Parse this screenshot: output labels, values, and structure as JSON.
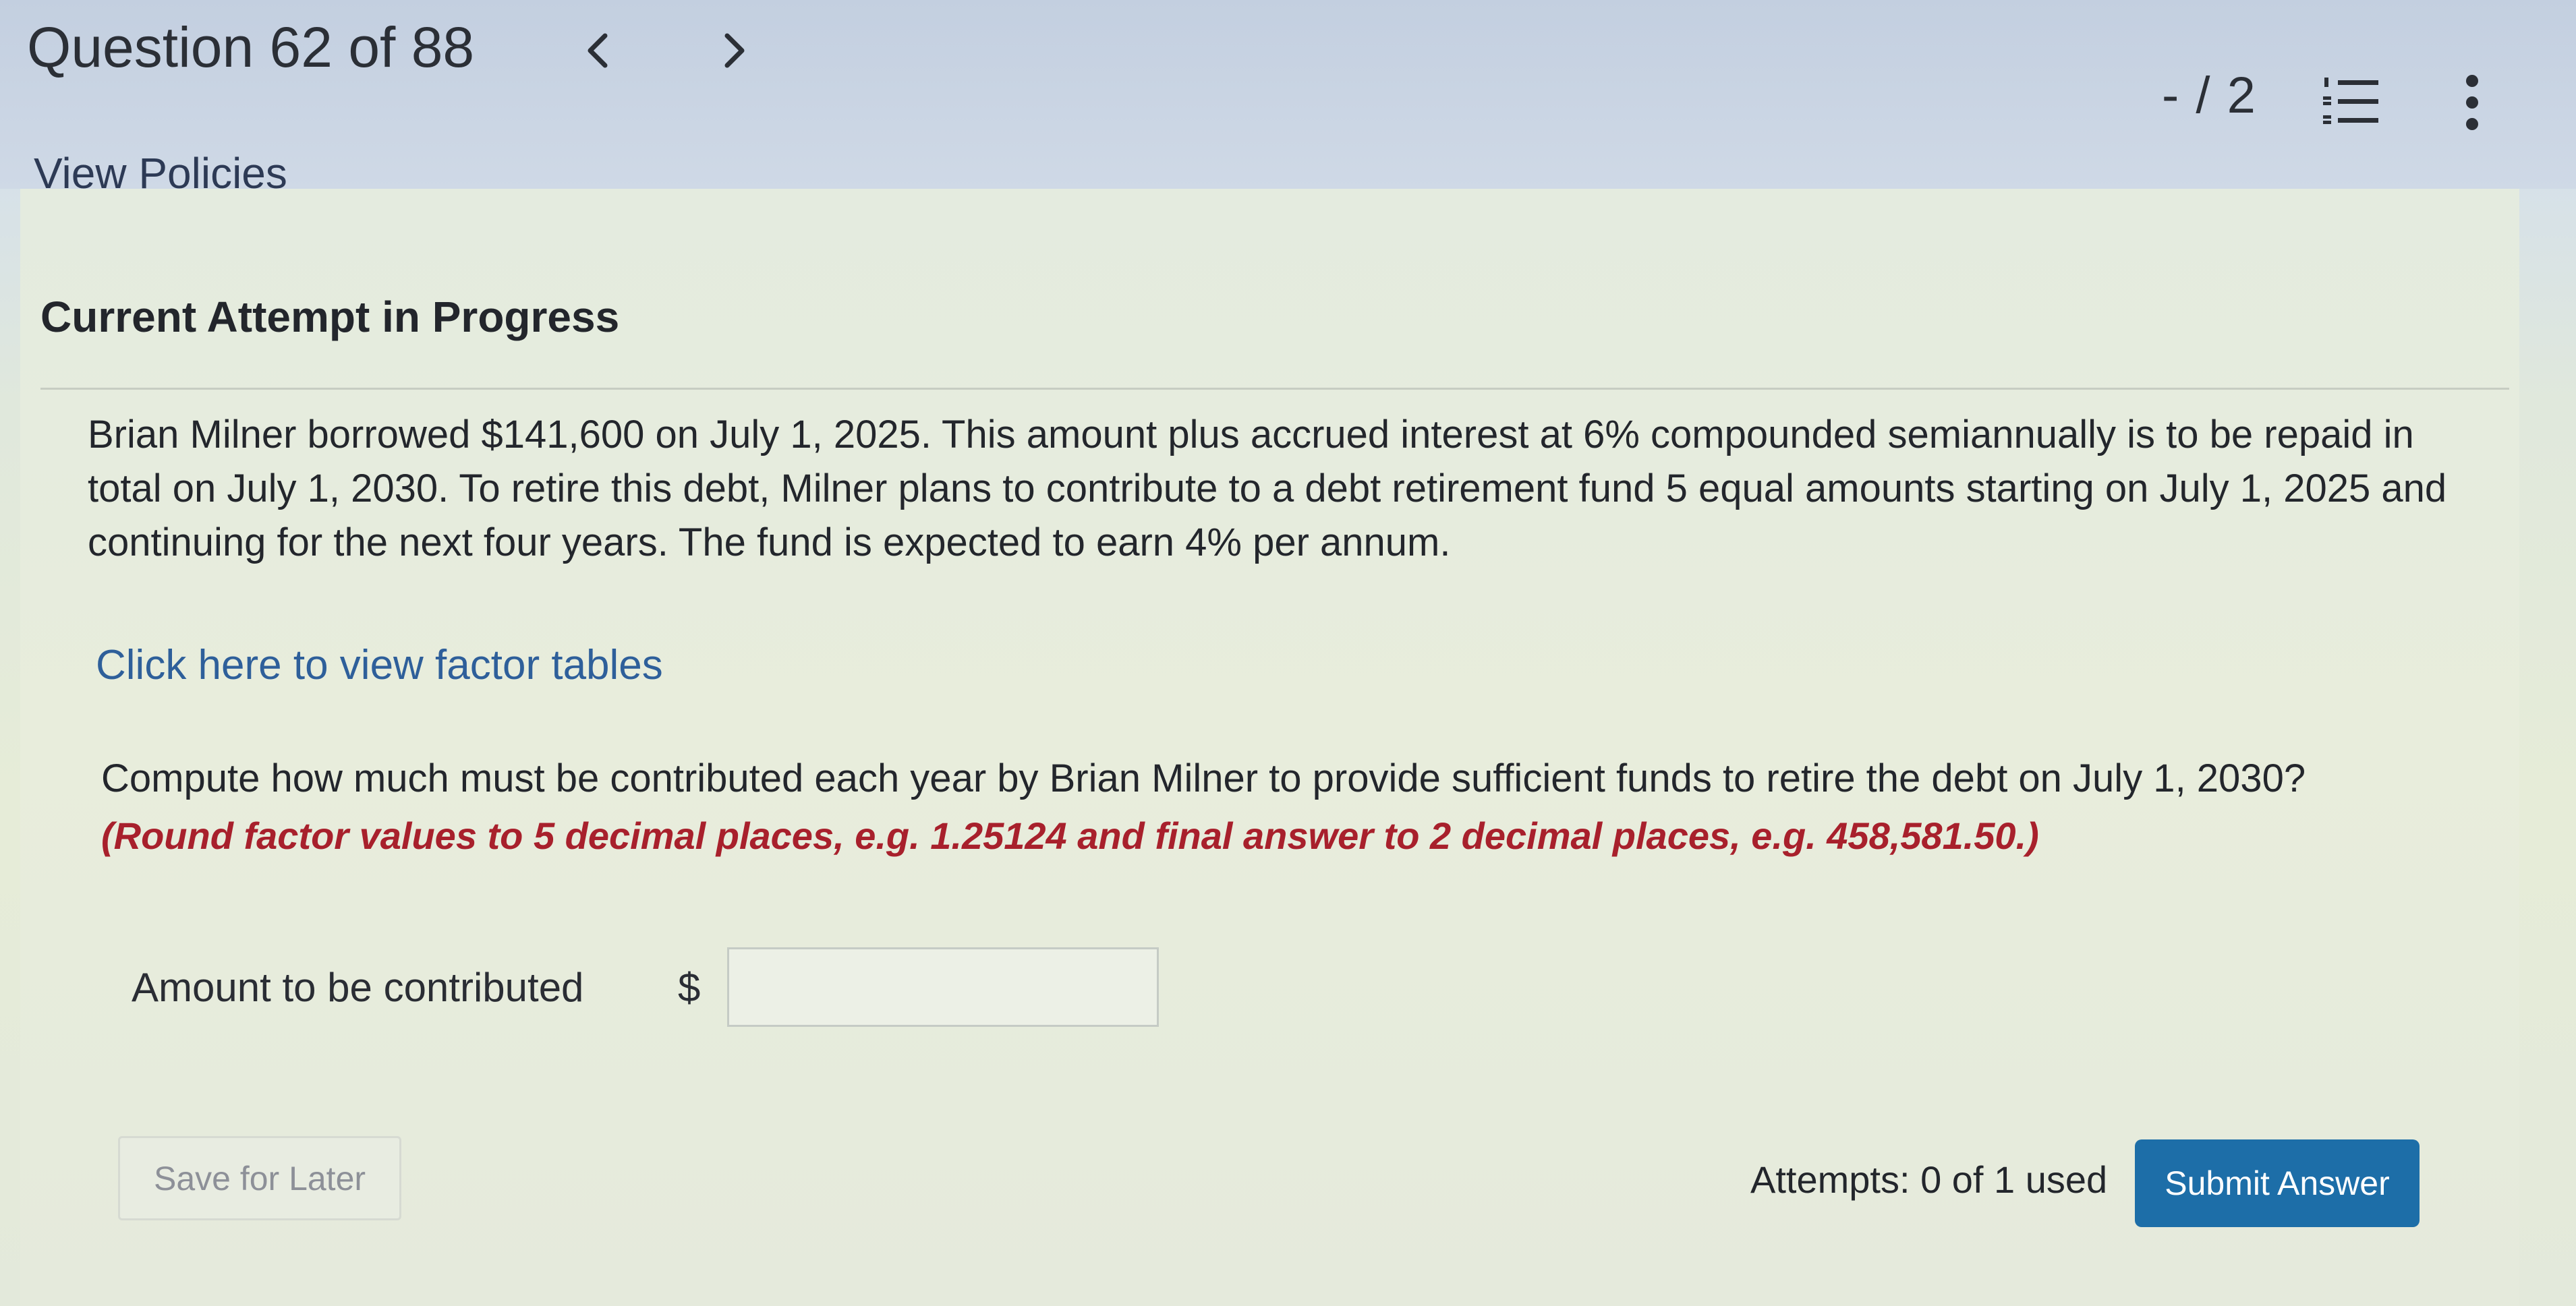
{
  "header": {
    "question_counter": "Question 62 of 88",
    "prev_icon": "chevron-left-icon",
    "next_icon": "chevron-right-icon",
    "points": "- / 2",
    "list_icon": "numbered-list-icon",
    "more_icon": "more-vertical-icon",
    "view_policies": "View Policies"
  },
  "main": {
    "attempt_heading": "Current Attempt in Progress",
    "problem_text": "Brian Milner borrowed $141,600 on July 1, 2025. This amount plus accrued interest at 6% compounded semiannually is to be repaid in total on July 1, 2030. To retire this debt, Milner plans to contribute to a debt retirement fund 5 equal amounts starting on July 1, 2025 and continuing for the next four years. The fund is expected to earn 4% per annum.",
    "factor_tables_link": "Click here to view factor tables",
    "question_text": "Compute how much must be contributed each year by Brian Milner to provide sufficient funds to retire the debt on July 1, 2030?",
    "rounding_note": "(Round factor values to 5 decimal places, e.g. 1.25124 and final answer to 2 decimal places, e.g. 458,581.50.)",
    "answer": {
      "label": "Amount to be contributed",
      "currency": "$",
      "value": ""
    }
  },
  "footer": {
    "save_label": "Save for Later",
    "attempts": "Attempts: 0 of 1 used",
    "submit_label": "Submit Answer"
  },
  "colors": {
    "link": "#2e5f9a",
    "note_red": "#a8202c",
    "submit_blue": "#1d6ea8",
    "header_bg": "#c3cfe0",
    "content_bg": "#e6ecdc"
  }
}
